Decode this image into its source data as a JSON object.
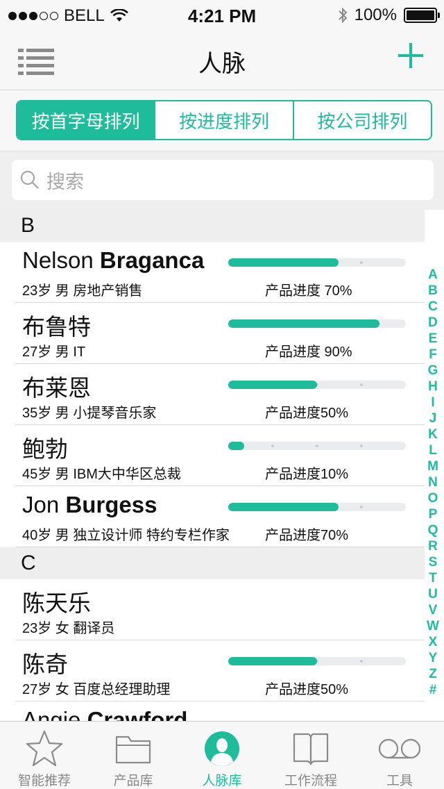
{
  "status_bar": {
    "carrier": "BELL",
    "time": "4:21 PM",
    "battery": "100%"
  },
  "nav": {
    "title": "人脉"
  },
  "segments": [
    {
      "label": "按首字母排列",
      "active": true
    },
    {
      "label": "按进度排列",
      "active": false
    },
    {
      "label": "按公司排列",
      "active": false
    }
  ],
  "search": {
    "placeholder": "搜索"
  },
  "sections": [
    {
      "letter": "B",
      "contacts": [
        {
          "name_first": "Nelson ",
          "name_last": "Braganca",
          "info": "23岁  男  房地产销售",
          "progress_label": "产品进度  70%",
          "progress": 0.62
        },
        {
          "name_first": "布鲁特",
          "name_last": "",
          "info": "27岁  男  IT",
          "progress_label": "产品进度  90%",
          "progress": 0.85
        },
        {
          "name_first": "布莱恩",
          "name_last": "",
          "info": "35岁  男  小提琴音乐家",
          "progress_label": "产品进度50%",
          "progress": 0.5
        },
        {
          "name_first": "鲍勃",
          "name_last": "",
          "info": "45岁  男  IBM大中华区总裁",
          "progress_label": "产品进度10%",
          "progress": 0.09
        },
        {
          "name_first": "Jon ",
          "name_last": "Burgess",
          "info": "40岁  男  独立设计师  特约专栏作家",
          "progress_label": "产品进度70%",
          "progress": 0.62
        }
      ]
    },
    {
      "letter": "C",
      "contacts": [
        {
          "name_first": "陈天乐",
          "name_last": "",
          "info": "23岁  女  翻译员",
          "progress_label": "",
          "progress": null
        },
        {
          "name_first": "陈奇",
          "name_last": "",
          "info": "27岁  女  百度总经理助理",
          "progress_label": "产品进度50%",
          "progress": 0.5
        },
        {
          "name_first": "Angie ",
          "name_last": "Crawford",
          "info": "",
          "progress_label": "",
          "progress": null
        }
      ]
    }
  ],
  "index_letters": [
    "A",
    "B",
    "C",
    "D",
    "E",
    "F",
    "G",
    "H",
    "I",
    "J",
    "K",
    "L",
    "M",
    "N",
    "O",
    "P",
    "Q",
    "R",
    "S",
    "T",
    "U",
    "V",
    "W",
    "X",
    "Y",
    "Z",
    "#"
  ],
  "tabs": [
    {
      "label": "智能推荐",
      "icon": "star-icon",
      "active": false
    },
    {
      "label": "产品库",
      "icon": "folder-icon",
      "active": false
    },
    {
      "label": "人脉库",
      "icon": "person-icon",
      "active": true
    },
    {
      "label": "工作流程",
      "icon": "book-icon",
      "active": false
    },
    {
      "label": "工具",
      "icon": "tools-icon",
      "active": false
    }
  ],
  "colors": {
    "accent": "#1fbc9c",
    "track": "#eaeced"
  }
}
